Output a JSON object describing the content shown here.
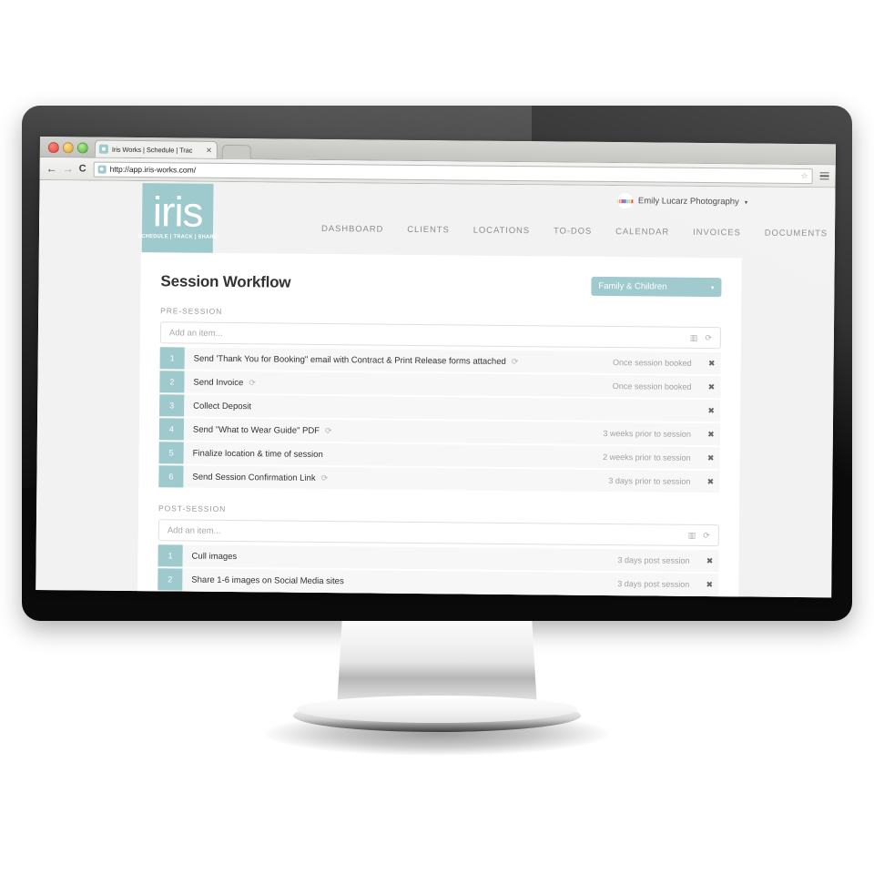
{
  "browser": {
    "tab_title": "Iris Works | Schedule | Trac",
    "tab_close": "✕",
    "url": "http://app.iris-works.com/",
    "back_icon": "←",
    "forward_icon": "→",
    "reload_icon": "C",
    "star_icon": "☆"
  },
  "header": {
    "logo_word": "iris",
    "logo_tagline": "SCHEDULE | TRACK | SHARE",
    "user_name": "Emily Lucarz Photography",
    "user_caret": "▾",
    "nav": [
      {
        "label": "DASHBOARD"
      },
      {
        "label": "CLIENTS"
      },
      {
        "label": "LOCATIONS"
      },
      {
        "label": "TO-DOS"
      },
      {
        "label": "CALENDAR"
      },
      {
        "label": "INVOICES"
      },
      {
        "label": "DOCUMENTS"
      }
    ]
  },
  "page": {
    "title": "Session Workflow",
    "workflow_select": {
      "value": "Family & Children",
      "caret": "▾"
    }
  },
  "icons": {
    "calendar": "▥",
    "repeat": "⟳",
    "delete": "✖"
  },
  "sections": [
    {
      "label": "PRE-SESSION",
      "add_placeholder": "Add an item...",
      "items": [
        {
          "num": "1",
          "text": "Send 'Thank You for Booking\" email with Contract & Print Release forms attached",
          "repeat": true,
          "when": "Once session booked"
        },
        {
          "num": "2",
          "text": "Send Invoice",
          "repeat": true,
          "when": "Once session booked"
        },
        {
          "num": "3",
          "text": "Collect Deposit",
          "repeat": false,
          "when": ""
        },
        {
          "num": "4",
          "text": "Send \"What to Wear Guide\" PDF",
          "repeat": true,
          "when": "3 weeks prior to session"
        },
        {
          "num": "5",
          "text": "Finalize location & time of session",
          "repeat": false,
          "when": "2 weeks prior to session"
        },
        {
          "num": "6",
          "text": "Send Session Confirmation Link",
          "repeat": true,
          "when": "3 days prior to session"
        }
      ]
    },
    {
      "label": "POST-SESSION",
      "add_placeholder": "Add an item...",
      "items": [
        {
          "num": "1",
          "text": "Cull images",
          "repeat": false,
          "when": "3 days post session"
        },
        {
          "num": "2",
          "text": "Share 1-6 images on Social Media sites",
          "repeat": false,
          "when": "3 days post session"
        }
      ]
    }
  ],
  "colors": {
    "accent_teal": "#9ec9cd",
    "page_bg": "#f2f2f2",
    "row_bg": "#f7f7f7",
    "text_dark": "#333333",
    "text_muted": "#a2a2a2"
  },
  "avatar_dot_colors": [
    "#f2c53d",
    "#e8553c",
    "#e84393",
    "#9b59b6",
    "#3ea6e8",
    "#2ecc71",
    "#f39c12",
    "#e74c3c"
  ]
}
